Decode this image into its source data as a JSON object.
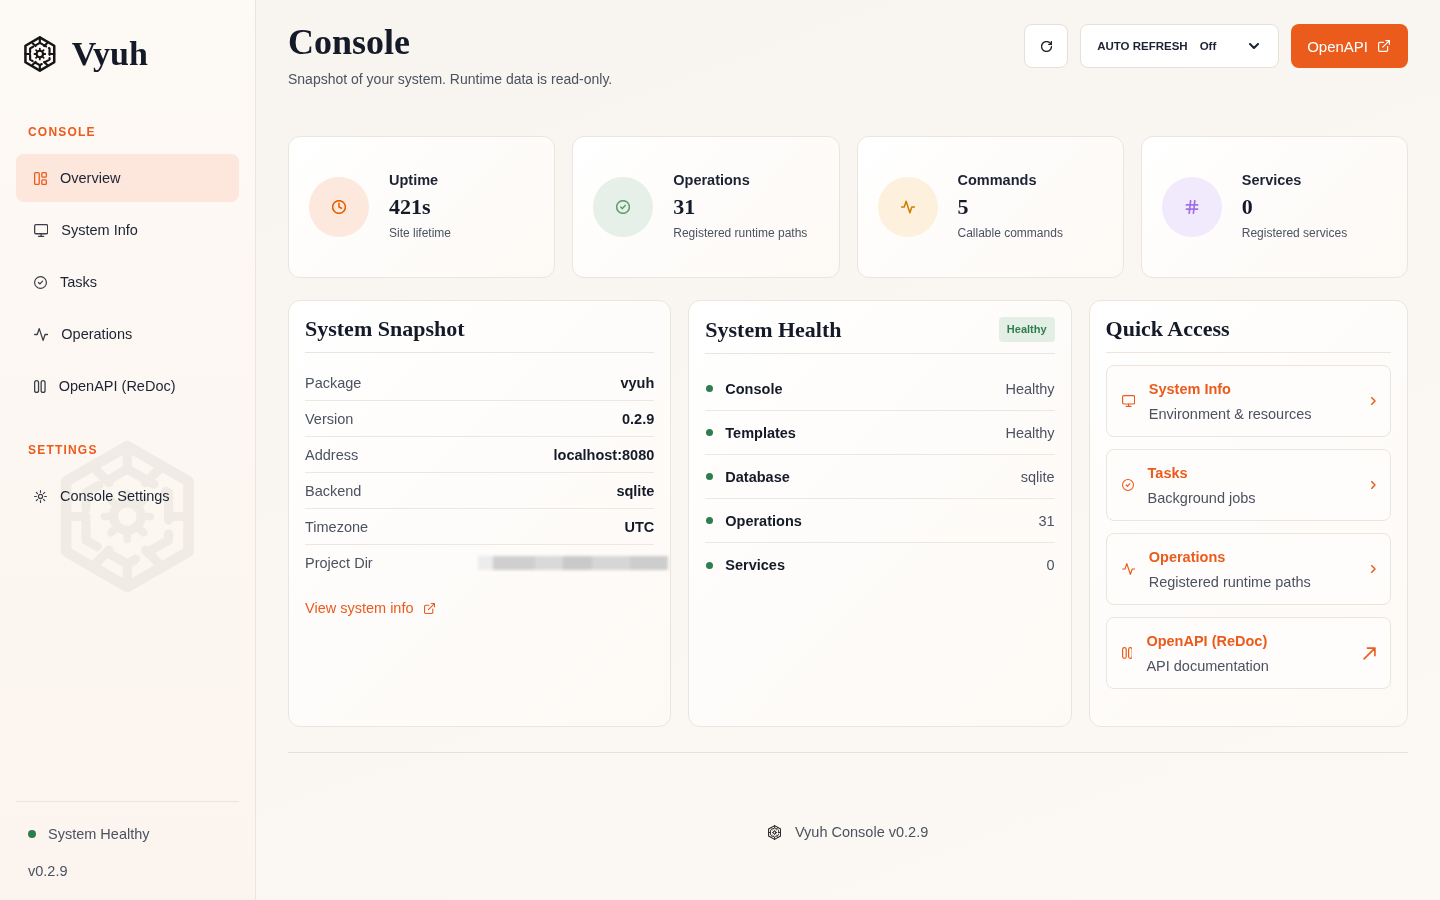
{
  "sidebar": {
    "brand": "Vyuh",
    "sections": [
      {
        "heading": "CONSOLE",
        "items": [
          {
            "label": "Overview",
            "selected": true
          },
          {
            "label": "System Info",
            "selected": false
          },
          {
            "label": "Tasks",
            "selected": false
          },
          {
            "label": "Operations",
            "selected": false
          },
          {
            "label": "OpenAPI (ReDoc)",
            "selected": false
          }
        ]
      },
      {
        "heading": "SETTINGS",
        "items": [
          {
            "label": "Console Settings",
            "selected": false
          }
        ]
      }
    ],
    "status": {
      "label": "System Healthy",
      "color": "#2e7d4f"
    },
    "version": "v0.2.9"
  },
  "header": {
    "title": "Console",
    "subtitle": "Snapshot of your system. Runtime data is read-only.",
    "auto_refresh": {
      "label": "AUTO REFRESH",
      "value": "Off"
    },
    "open_api_button": "OpenAPI"
  },
  "stats": [
    {
      "label": "Uptime",
      "value": "421s",
      "caption": "Site lifetime",
      "color": "#fde8de"
    },
    {
      "label": "Operations",
      "value": "31",
      "caption": "Registered runtime paths",
      "color": "#e6efe8"
    },
    {
      "label": "Commands",
      "value": "5",
      "caption": "Callable commands",
      "color": "#fdf1dd"
    },
    {
      "label": "Services",
      "value": "0",
      "caption": "Registered services",
      "color": "#f0eafc"
    }
  ],
  "system_snapshot": {
    "title": "System Snapshot",
    "rows": [
      {
        "kind": "text",
        "label": "Package",
        "value": "vyuh"
      },
      {
        "kind": "text",
        "label": "Version",
        "value": "0.2.9"
      },
      {
        "kind": "text",
        "label": "Address",
        "value": "localhost:8080"
      },
      {
        "kind": "text",
        "label": "Backend",
        "value": "sqlite"
      },
      {
        "kind": "text",
        "label": "Timezone",
        "value": "UTC"
      },
      {
        "kind": "redacted",
        "label": "Project Dir"
      }
    ],
    "link": "View system info"
  },
  "system_health": {
    "title": "System Health",
    "badge": "Healthy",
    "rows": [
      {
        "name": "Console",
        "value": "Healthy",
        "color": "#2e7d4f"
      },
      {
        "name": "Templates",
        "value": "Healthy",
        "color": "#2e7d4f"
      },
      {
        "name": "Database",
        "value": "sqlite",
        "color": "#2e7d4f"
      },
      {
        "name": "Operations",
        "value": "31",
        "color": "#2e7d4f"
      },
      {
        "name": "Services",
        "value": "0",
        "color": "#2e7d4f"
      }
    ]
  },
  "quick_access": {
    "title": "Quick Access",
    "items": [
      {
        "kind": "internal",
        "title": "System Info",
        "subtitle": "Environment & resources"
      },
      {
        "kind": "internal",
        "title": "Tasks",
        "subtitle": "Background jobs"
      },
      {
        "kind": "internal",
        "title": "Operations",
        "subtitle": "Registered runtime paths"
      },
      {
        "kind": "external",
        "title": "OpenAPI (ReDoc)",
        "subtitle": "API documentation"
      }
    ]
  },
  "footer": {
    "text": "Vyuh Console v0.2.9"
  }
}
